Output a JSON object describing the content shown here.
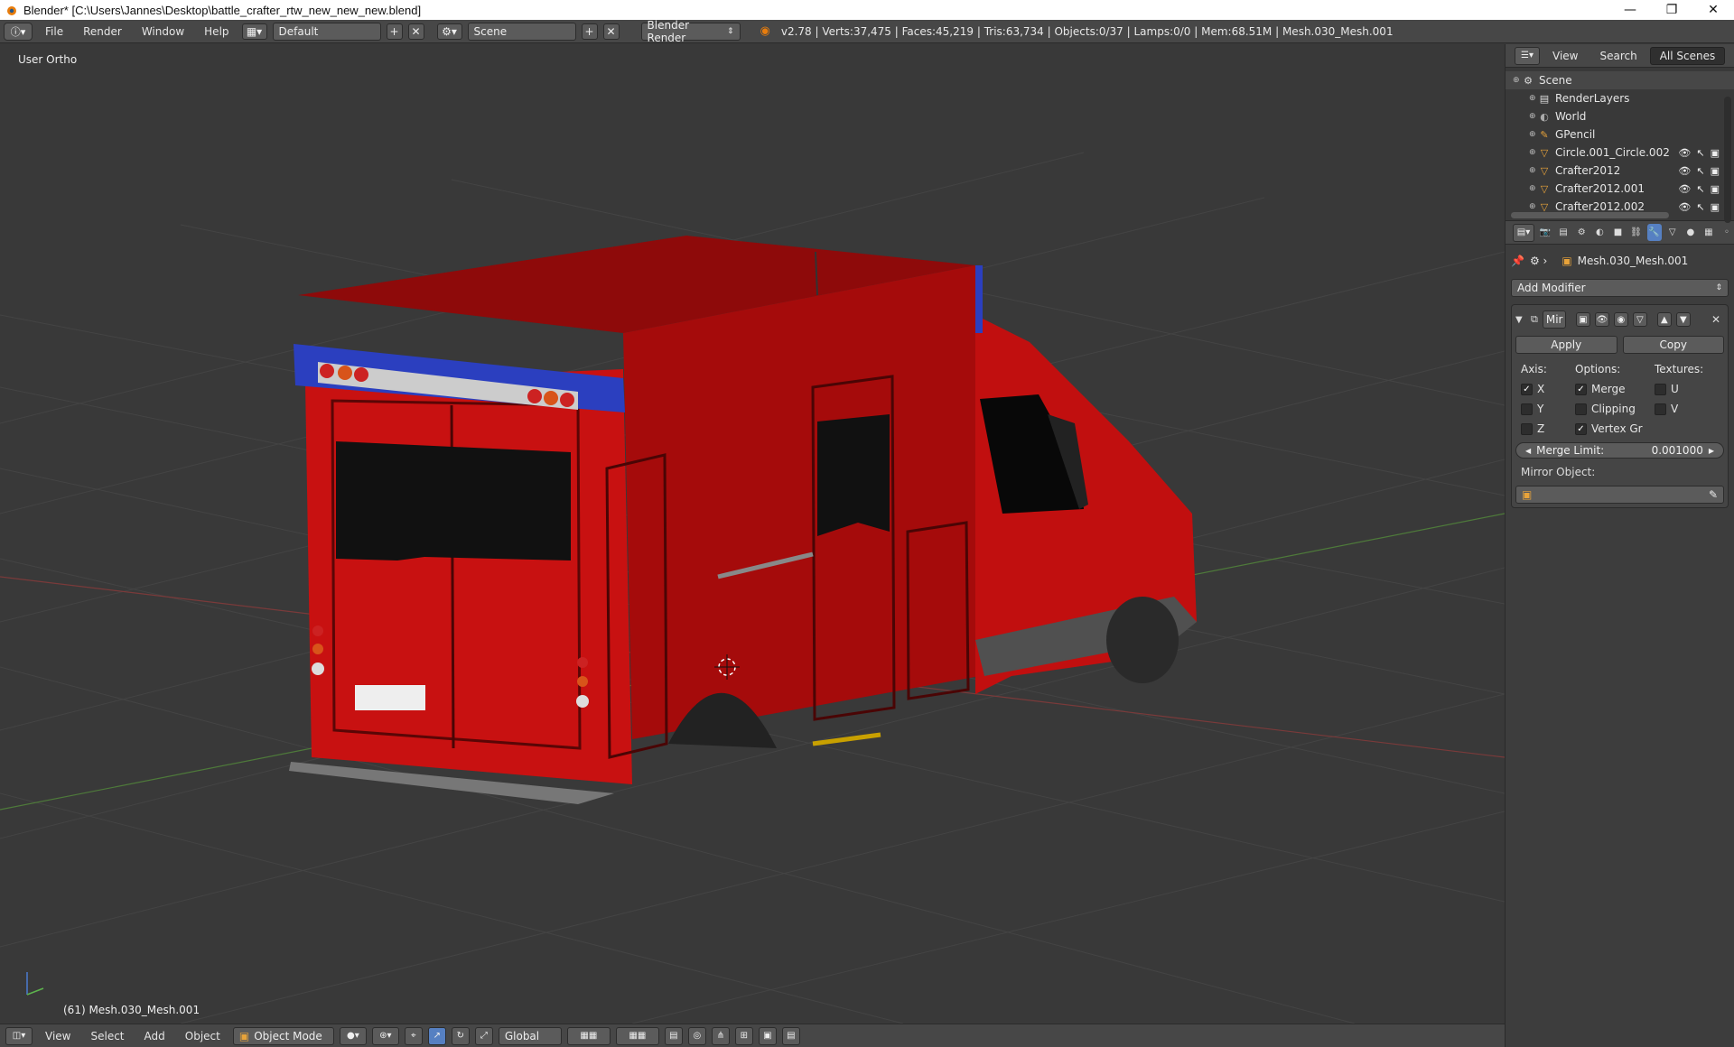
{
  "window": {
    "title": "Blender* [C:\\Users\\Jannes\\Desktop\\battle_crafter_rtw_new_new_new.blend]",
    "minimize": "—",
    "maximize": "❐",
    "close": "✕"
  },
  "menu": [
    "File",
    "Render",
    "Window",
    "Help"
  ],
  "header": {
    "layout": "Default",
    "scene": "Scene",
    "engine": "Blender Render",
    "stats": "v2.78 | Verts:37,475 | Faces:45,219 | Tris:63,734 | Objects:0/37 | Lamps:0/0 | Mem:68.51M | Mesh.030_Mesh.001"
  },
  "viewport": {
    "view_label": "User Ortho",
    "object_label": "(61) Mesh.030_Mesh.001"
  },
  "bottombar": {
    "menus": [
      "View",
      "Select",
      "Add",
      "Object"
    ],
    "mode": "Object Mode",
    "orientation": "Global"
  },
  "outliner": {
    "tabs": [
      "View",
      "Search",
      "All Scenes"
    ],
    "items": [
      {
        "label": "Scene",
        "icon": "scene-icon",
        "depth": 0
      },
      {
        "label": "RenderLayers",
        "icon": "renderlayers-icon",
        "depth": 1
      },
      {
        "label": "World",
        "icon": "world-icon",
        "depth": 1
      },
      {
        "label": "GPencil",
        "icon": "gpencil-icon",
        "depth": 1
      },
      {
        "label": "Circle.001_Circle.002",
        "icon": "mesh-object-icon",
        "depth": 1
      },
      {
        "label": "Crafter2012",
        "icon": "mesh-object-icon",
        "depth": 1
      },
      {
        "label": "Crafter2012.001",
        "icon": "mesh-object-icon",
        "depth": 1
      },
      {
        "label": "Crafter2012.002",
        "icon": "mesh-object-icon",
        "depth": 1
      }
    ]
  },
  "properties": {
    "object_name": "Mesh.030_Mesh.001",
    "add_modifier": "Add Modifier",
    "modifier": {
      "name": "Mir",
      "apply": "Apply",
      "copy": "Copy",
      "axis_label": "Axis:",
      "options_label": "Options:",
      "textures_label": "Textures:",
      "axis": [
        {
          "label": "X",
          "checked": true
        },
        {
          "label": "Y",
          "checked": false
        },
        {
          "label": "Z",
          "checked": false
        }
      ],
      "options": [
        {
          "label": "Merge",
          "checked": true
        },
        {
          "label": "Clipping",
          "checked": false
        },
        {
          "label": "Vertex Gr",
          "checked": true
        }
      ],
      "textures": [
        {
          "label": "U",
          "checked": false
        },
        {
          "label": "V",
          "checked": false
        }
      ],
      "merge_limit_label": "Merge Limit:",
      "merge_limit_value": "0.001000",
      "mirror_object_label": "Mirror Object:"
    }
  },
  "colors": {
    "vehicle_red": "#b80d0d",
    "light_blue": "#2b3fbf",
    "accent": "#5680c2"
  }
}
